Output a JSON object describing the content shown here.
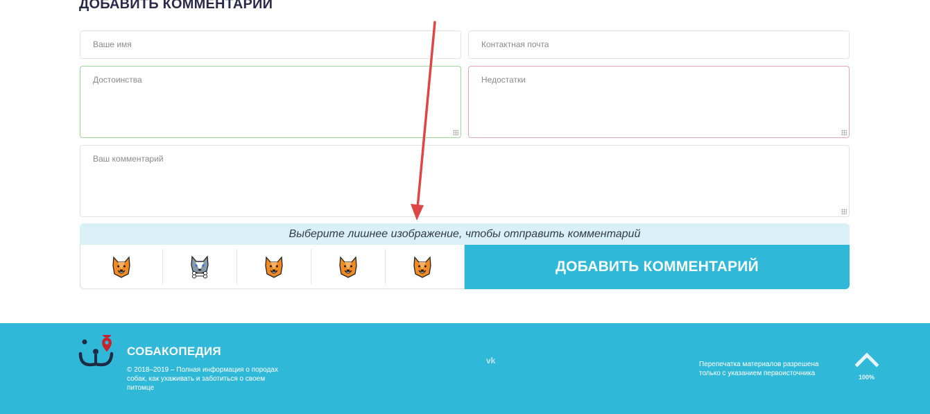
{
  "form": {
    "title": "ДОБАВИТЬ КОММЕНТАРИЙ",
    "name_placeholder": "Ваше имя",
    "email_placeholder": "Контактная почта",
    "pros_placeholder": "Достоинства",
    "cons_placeholder": "Недостатки",
    "comment_placeholder": "Ваш комментарий"
  },
  "captcha": {
    "prompt": "Выберите лишнее изображение, чтобы отправить комментарий",
    "icons": [
      "dog-face-icon",
      "husky-bone-icon",
      "dog-face-icon",
      "dog-face-icon",
      "dog-face-icon"
    ]
  },
  "submit_label": "ДОБАВИТЬ КОММЕНТАРИЙ",
  "footer": {
    "brand": "СОБАКОПЕДИЯ",
    "copyright": "© 2018–2019 – Полная информация о породах собак, как ухаживать и заботиться о своем питомце",
    "vk_label": "vk",
    "reprint": "Перепечатка материалов разрешена только с указанием первоисточника",
    "scroll_percent": "100%"
  },
  "colors": {
    "accent": "#30b8d8",
    "annotation_arrow": "#e04545"
  }
}
